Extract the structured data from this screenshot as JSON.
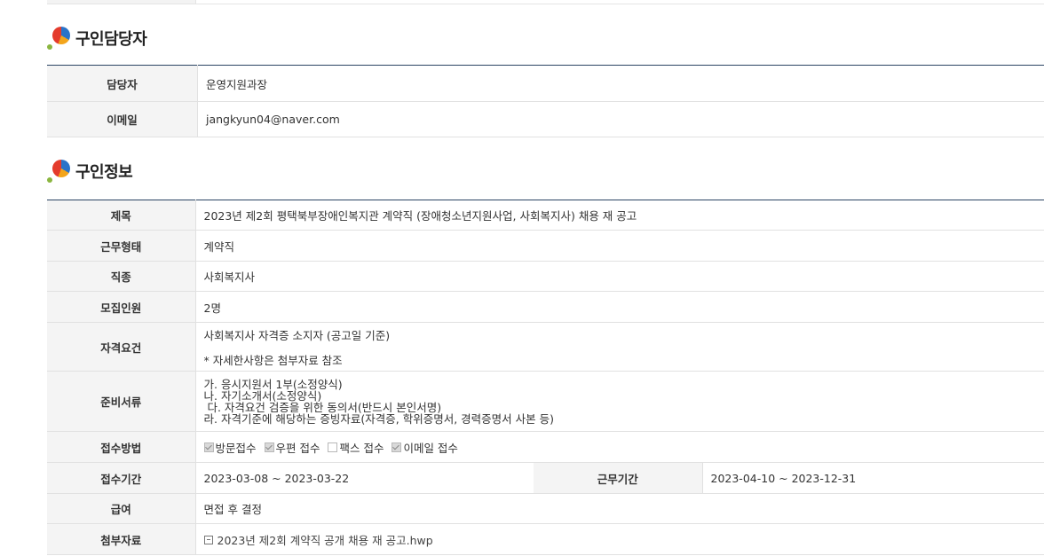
{
  "recruiter_section": {
    "title": "구인담당자",
    "rows": [
      {
        "label": "담당자",
        "value": "운영지원과장"
      },
      {
        "label": "이메일",
        "value": "jangkyun04@naver.com"
      }
    ]
  },
  "job_section": {
    "title": "구인정보",
    "subject": {
      "label": "제목",
      "value": "2023년 제2회 평택북부장애인복지관 계약직 (장애청소년지원사업, 사회복지사) 채용 재 공고"
    },
    "work_type": {
      "label": "근무형태",
      "value": "계약직"
    },
    "occupation": {
      "label": "직종",
      "value": "사회복지사"
    },
    "headcount": {
      "label": "모집인원",
      "value": "2명"
    },
    "qualification": {
      "label": "자격요건",
      "line1": "사회복지사 자격증 소지자 (공고일 기준)",
      "line2": "* 자세한사항은 첨부자료 참조"
    },
    "documents": {
      "label": "준비서류",
      "lines": [
        "가. 응시지원서 1부(소정양식)",
        "나. 자기소개서(소정양식)",
        " 다. 자격요건 검증을 위한 동의서(반드시 본인서명)",
        "라. 자격기준에 해당하는 증빙자료(자격증, 학위증명서, 경력증명서 사본 등)"
      ]
    },
    "application_method": {
      "label": "접수방법",
      "options": [
        {
          "label": "방문접수",
          "checked": true
        },
        {
          "label": "우편 접수",
          "checked": true
        },
        {
          "label": "팩스 접수",
          "checked": false
        },
        {
          "label": "이메일 접수",
          "checked": true
        }
      ]
    },
    "application_period": {
      "label": "접수기간",
      "value": "2023-03-08 ~ 2023-03-22"
    },
    "work_period": {
      "label": "근무기간",
      "value": "2023-04-10 ~ 2023-12-31"
    },
    "salary": {
      "label": "급여",
      "value": "면접 후 결정"
    },
    "attachment": {
      "label": "첨부자료",
      "file": "2023년 제2회 계약직 공개 채용 재 공고.hwp"
    }
  }
}
